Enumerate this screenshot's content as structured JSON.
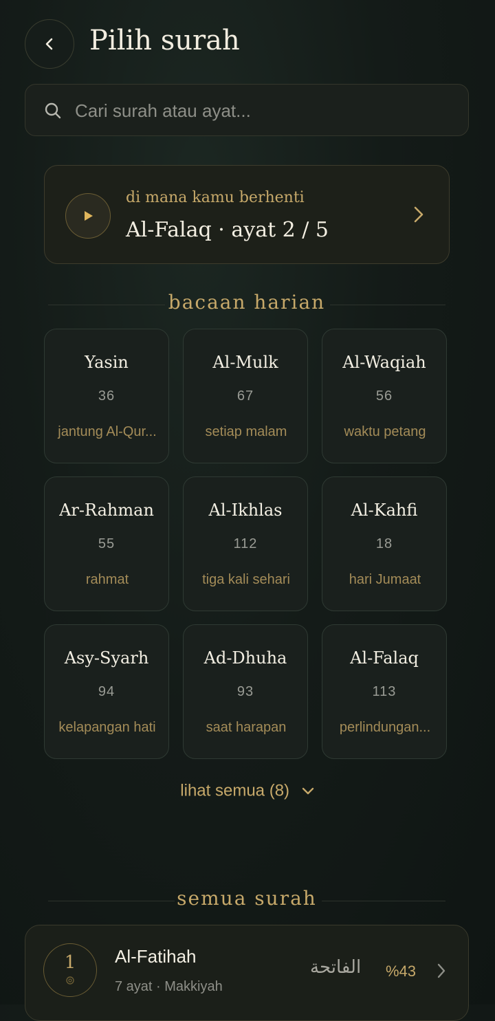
{
  "header": {
    "title": "Pilih surah"
  },
  "search": {
    "placeholder": "Cari surah atau ayat..."
  },
  "resume": {
    "label": "di mana kamu berhenti",
    "value": "Al-Falaq · ayat 2 / 5"
  },
  "daily": {
    "heading": "bacaan harian",
    "items": [
      {
        "name": "Yasin",
        "number": "36",
        "desc": "jantung Al-Qur..."
      },
      {
        "name": "Al-Mulk",
        "number": "67",
        "desc": "setiap malam"
      },
      {
        "name": "Al-Waqiah",
        "number": "56",
        "desc": "waktu petang"
      },
      {
        "name": "Ar-Rahman",
        "number": "55",
        "desc": "rahmat"
      },
      {
        "name": "Al-Ikhlas",
        "number": "112",
        "desc": "tiga kali sehari"
      },
      {
        "name": "Al-Kahfi",
        "number": "18",
        "desc": "hari Jumaat"
      },
      {
        "name": "Asy-Syarh",
        "number": "94",
        "desc": "kelapangan hati"
      },
      {
        "name": "Ad-Dhuha",
        "number": "93",
        "desc": "saat harapan"
      },
      {
        "name": "Al-Falaq",
        "number": "113",
        "desc": "perlindungan..."
      }
    ],
    "see_all": "lihat semua (8)"
  },
  "all_surah": {
    "heading": "semua surah",
    "items": [
      {
        "number": "1",
        "name": "Al-Fatihah",
        "meta": "7 ayat · Makkiyah",
        "arabic": "الفاتحة",
        "progress": "%43"
      }
    ]
  },
  "colors": {
    "accent": "#c7a96a",
    "background": "#141b18",
    "card": "#1a201d"
  }
}
